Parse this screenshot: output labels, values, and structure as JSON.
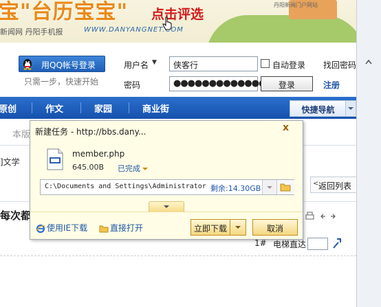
{
  "banner": {
    "headline": "宝\"台历宝宝\"",
    "cta": "点击评选",
    "subtitle": "新闻网 丹阳手机报",
    "site": "WWW.DANYANGNET.COM",
    "portal": "丹阳新闻门户网站"
  },
  "login": {
    "qq_button": "用QQ帐号登录",
    "qq_hint": "只需一步，快速开始",
    "username_label": "用户名",
    "username_value": "侠客行",
    "password_label": "密码",
    "password_value": "●●●●●●●●●●●●●●●",
    "auto_login": "自动登录",
    "login_button": "登录",
    "find_password": "找回密码",
    "register": "注册"
  },
  "nav": {
    "items": [
      "原创",
      "作文",
      "家园",
      "商业街"
    ],
    "quick_nav": "快捷导航"
  },
  "page": {
    "tab_partial": "本版",
    "crumb_partial": "]文学",
    "back_to_list": "返回列表",
    "title_partial": "每次都",
    "floor": "1#",
    "elevator_label": "电梯直达"
  },
  "dialog": {
    "title": "新建任务 - http://bbs.dany...",
    "close": "x",
    "file_name": "member.php",
    "file_size": "645.00B",
    "status": "已完成",
    "path": "C:\\Documents and Settings\\Administrator",
    "free_space": "剩余:14.30GB",
    "ie_download": "使用IE下载",
    "open_direct": "直接打开",
    "download_now": "立即下载",
    "cancel": "取消"
  },
  "colors": {
    "nav_blue": "#1f5fbe",
    "dialog_bg": "#fffde5",
    "link_blue": "#1f56a8"
  }
}
